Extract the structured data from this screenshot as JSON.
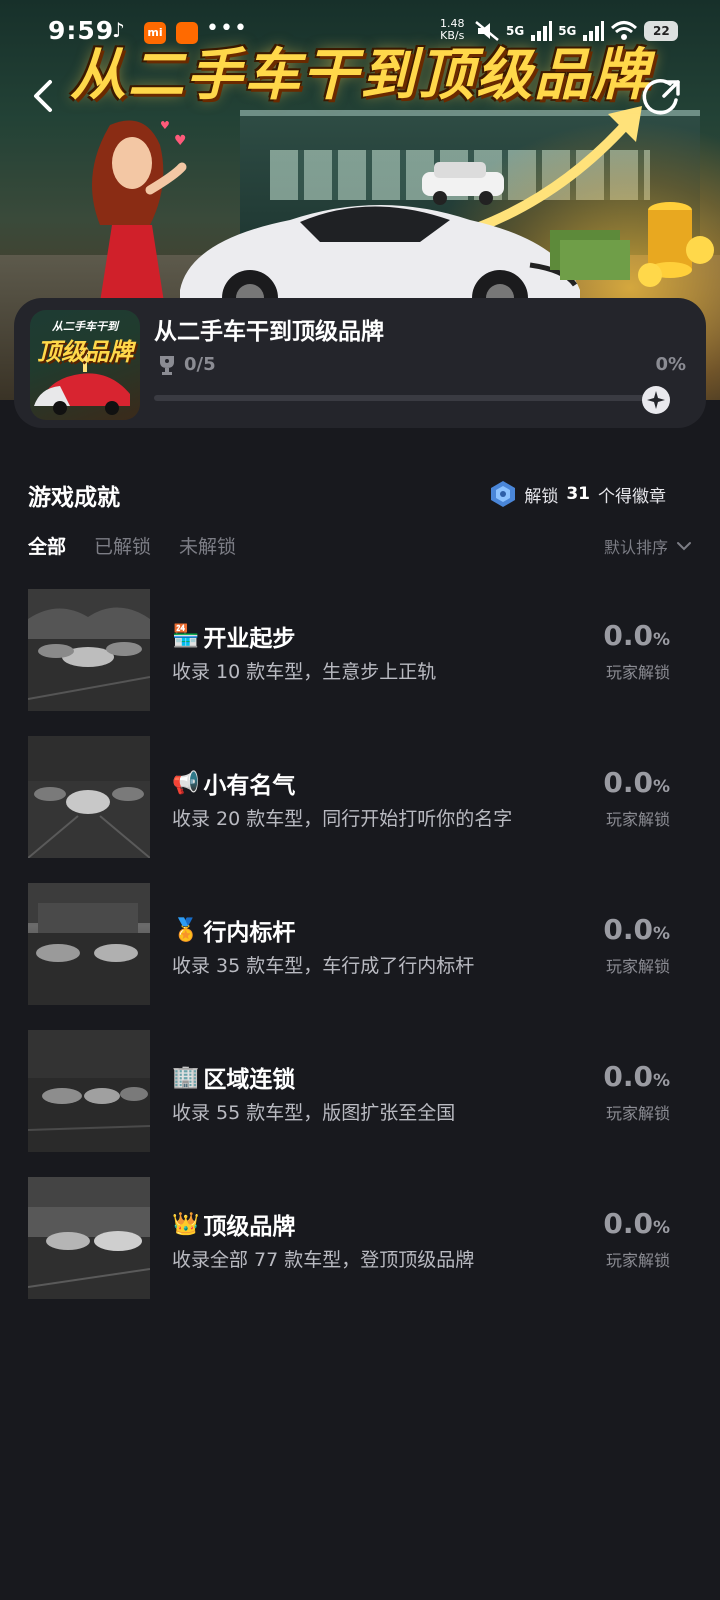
{
  "status_bar": {
    "time": "9:59",
    "net_speed_value": "1.48",
    "net_speed_unit": "KB/s",
    "sim1": "5G",
    "sim2": "5G",
    "battery": "22"
  },
  "banner": {
    "title": "从二手车干到顶级品牌"
  },
  "game": {
    "icon_text_top": "从二手车干到",
    "icon_text_main": "顶级品牌",
    "title": "从二手车干到顶级品牌",
    "progress_count": "0/5",
    "progress_percent": "0%",
    "progress_value": 0
  },
  "achievements_section": {
    "title": "游戏成就",
    "badge_prefix": "解锁",
    "badge_count": "31",
    "badge_suffix": "个得徽章",
    "tabs": [
      "全部",
      "已解锁",
      "未解锁"
    ],
    "sort_label": "默认排序"
  },
  "achievements": [
    {
      "emoji": "🏪",
      "title": "开业起步",
      "desc": "收录 10 款车型，生意步上正轨",
      "rate": "0.0",
      "rate_unit": "%",
      "rate_label": "玩家解锁"
    },
    {
      "emoji": "📢",
      "title": "小有名气",
      "desc": "收录 20 款车型，同行开始打听你的名字",
      "rate": "0.0",
      "rate_unit": "%",
      "rate_label": "玩家解锁"
    },
    {
      "emoji": "🏅",
      "title": "行内标杆",
      "desc": "收录 35 款车型，车行成了行内标杆",
      "rate": "0.0",
      "rate_unit": "%",
      "rate_label": "玩家解锁"
    },
    {
      "emoji": "🏢",
      "title": "区域连锁",
      "desc": "收录 55 款车型，版图扩张至全国",
      "rate": "0.0",
      "rate_unit": "%",
      "rate_label": "玩家解锁"
    },
    {
      "emoji": "👑",
      "title": "顶级品牌",
      "desc": "收录全部 77 款车型，登顶顶级品牌",
      "rate": "0.0",
      "rate_unit": "%",
      "rate_label": "玩家解锁"
    }
  ],
  "colors": {
    "background": "#18191e",
    "card": "#24252b",
    "title_gold": "#ffd84a",
    "muted": "#8b8c93"
  }
}
